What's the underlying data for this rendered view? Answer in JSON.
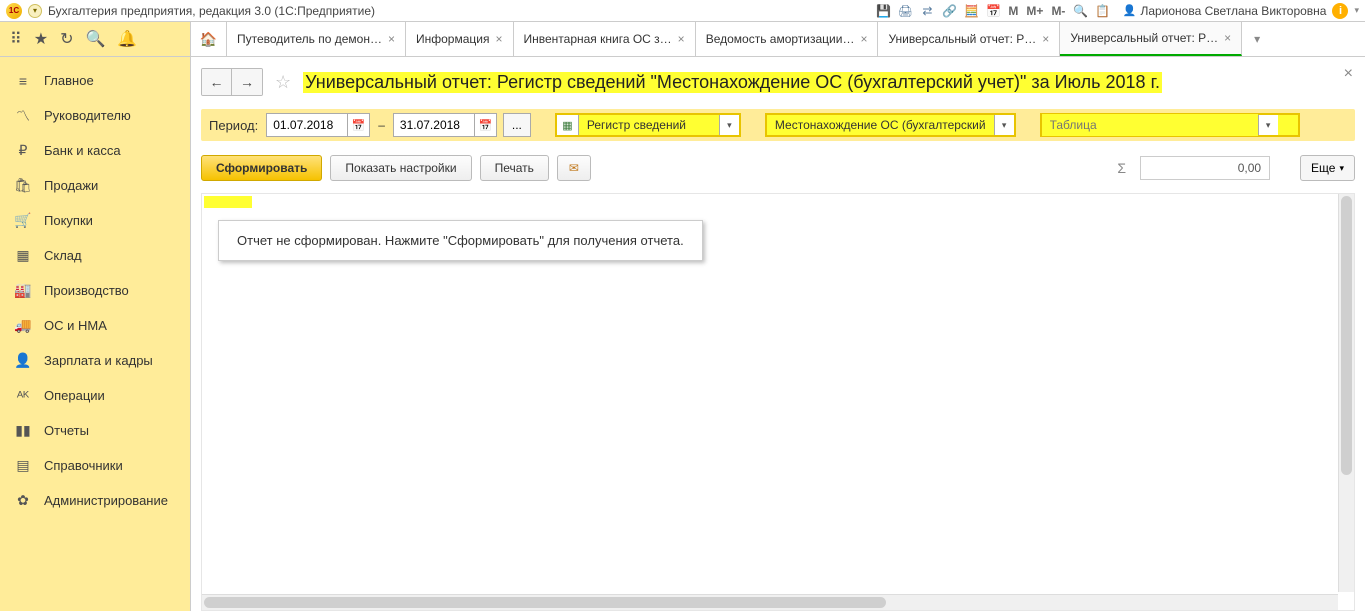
{
  "app": {
    "logo_text": "1C",
    "title": "Бухгалтерия предприятия, редакция 3.0  (1С:Предприятие)",
    "user_name": "Ларионова Светлана Викторовна"
  },
  "title_toolbar": {
    "m": "M",
    "m_plus": "M+",
    "m_minus": "M-"
  },
  "tabs": [
    {
      "label": "Путеводитель по демон…",
      "active": false
    },
    {
      "label": "Информация",
      "active": false
    },
    {
      "label": "Инвентарная книга ОС з…",
      "active": false
    },
    {
      "label": "Ведомость амортизации…",
      "active": false
    },
    {
      "label": "Универсальный отчет: Р…",
      "active": false
    },
    {
      "label": "Универсальный отчет: Р…",
      "active": true
    }
  ],
  "sidebar": [
    {
      "icon": "≡",
      "label": "Главное"
    },
    {
      "icon": "〽",
      "label": "Руководителю"
    },
    {
      "icon": "₽",
      "label": "Банк и касса"
    },
    {
      "icon": "🛍",
      "label": "Продажи"
    },
    {
      "icon": "🛒",
      "label": "Покупки"
    },
    {
      "icon": "▦",
      "label": "Склад"
    },
    {
      "icon": "🏭",
      "label": "Производство"
    },
    {
      "icon": "🚚",
      "label": "ОС и НМА"
    },
    {
      "icon": "👤",
      "label": "Зарплата и кадры"
    },
    {
      "icon": "ᴬᴷ",
      "label": "Операции"
    },
    {
      "icon": "▮▮",
      "label": "Отчеты"
    },
    {
      "icon": "▤",
      "label": "Справочники"
    },
    {
      "icon": "✿",
      "label": "Администрирование"
    }
  ],
  "page": {
    "title": "Универсальный отчет: Регистр сведений \"Местонахождение ОС (бухгалтерский учет)\" за Июль 2018 г.",
    "close": "×"
  },
  "filter": {
    "period_label": "Период:",
    "date_from": "01.07.2018",
    "date_to": "31.07.2018",
    "dash": "–",
    "dots": "...",
    "registry_label": "Регистр сведений",
    "location_label": "Местонахождение ОС (бухгалтерский",
    "table_placeholder": "Таблица"
  },
  "actions": {
    "generate": "Сформировать",
    "show_settings": "Показать настройки",
    "print": "Печать",
    "sum_value": "0,00",
    "more": "Еще"
  },
  "report": {
    "empty_message": "Отчет не сформирован. Нажмите \"Сформировать\" для получения отчета."
  }
}
